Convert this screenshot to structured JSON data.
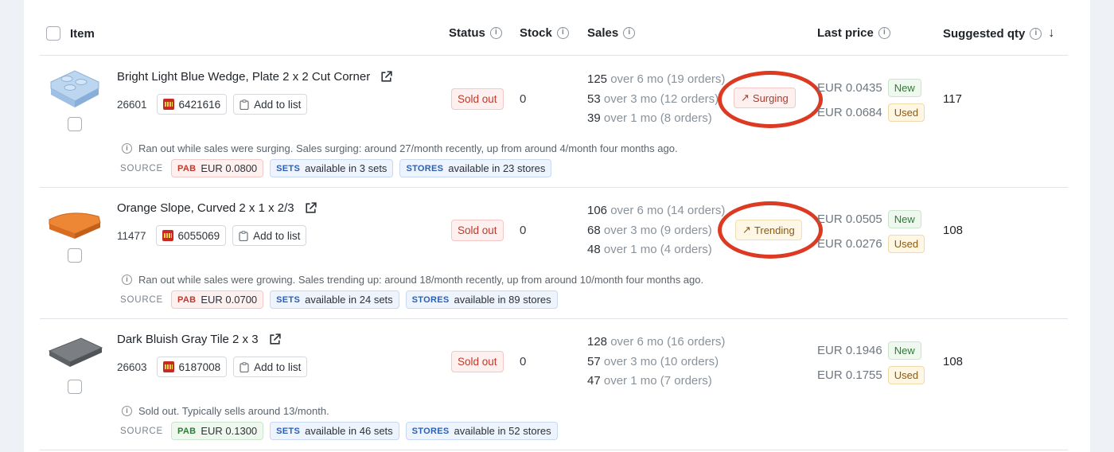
{
  "header": {
    "item": "Item",
    "status": "Status",
    "stock": "Stock",
    "sales": "Sales",
    "last_price": "Last price",
    "suggested_qty": "Suggested qty",
    "info_glyph": "i",
    "sort_glyph": "↓"
  },
  "rows": [
    {
      "title": "Bright Light Blue Wedge, Plate 2 x 2 Cut Corner",
      "part_no": "26601",
      "element_id": "6421616",
      "add_to_list": "Add to list",
      "status": "Sold out",
      "stock": "0",
      "sales": [
        {
          "count": "125",
          "text": "over 6 mo (19 orders)"
        },
        {
          "count": "53",
          "text": "over 3 mo (12 orders)"
        },
        {
          "count": "39",
          "text": "over 1 mo (8 orders)"
        }
      ],
      "trend_label": "Surging",
      "prices": [
        {
          "value": "EUR 0.0435",
          "tag": "New"
        },
        {
          "value": "EUR 0.0684",
          "tag": "Used"
        }
      ],
      "suggested_qty": "117",
      "note": "Ran out while sales were surging. Sales surging: around 27/month recently, up from around 4/month four months ago.",
      "source_label": "SOURCE",
      "pab_key": "PAB",
      "pab_value": "EUR 0.0800",
      "sets_key": "SETS",
      "sets_value": "available in 3 sets",
      "stores_key": "STORES",
      "stores_value": "available in 23 stores",
      "thumb_color": "#a9c9ea"
    },
    {
      "title": "Orange Slope, Curved 2 x 1 x 2/3",
      "part_no": "11477",
      "element_id": "6055069",
      "add_to_list": "Add to list",
      "status": "Sold out",
      "stock": "0",
      "sales": [
        {
          "count": "106",
          "text": "over 6 mo (14 orders)"
        },
        {
          "count": "68",
          "text": "over 3 mo (9 orders)"
        },
        {
          "count": "48",
          "text": "over 1 mo (4 orders)"
        }
      ],
      "trend_label": "Trending",
      "prices": [
        {
          "value": "EUR 0.0505",
          "tag": "New"
        },
        {
          "value": "EUR 0.0276",
          "tag": "Used"
        }
      ],
      "suggested_qty": "108",
      "note": "Ran out while sales were growing. Sales trending up: around 18/month recently, up from around 10/month four months ago.",
      "source_label": "SOURCE",
      "pab_key": "PAB",
      "pab_value": "EUR 0.0700",
      "sets_key": "SETS",
      "sets_value": "available in 24 sets",
      "stores_key": "STORES",
      "stores_value": "available in 89 stores",
      "thumb_color": "#e8772e"
    },
    {
      "title": "Dark Bluish Gray Tile 2 x 3",
      "part_no": "26603",
      "element_id": "6187008",
      "add_to_list": "Add to list",
      "status": "Sold out",
      "stock": "0",
      "sales": [
        {
          "count": "128",
          "text": "over 6 mo (16 orders)"
        },
        {
          "count": "57",
          "text": "over 3 mo (10 orders)"
        },
        {
          "count": "47",
          "text": "over 1 mo (7 orders)"
        }
      ],
      "trend_label": "",
      "prices": [
        {
          "value": "EUR 0.1946",
          "tag": "New"
        },
        {
          "value": "EUR 0.1755",
          "tag": "Used"
        }
      ],
      "suggested_qty": "108",
      "note": "Sold out. Typically sells around 13/month.",
      "source_label": "SOURCE",
      "pab_key": "PAB",
      "pab_value": "EUR 0.1300",
      "sets_key": "SETS",
      "sets_value": "available in 46 sets",
      "stores_key": "STORES",
      "stores_value": "available in 52 stores",
      "thumb_color": "#6c6f73"
    }
  ],
  "colors": {
    "sold_out": "#c0392b",
    "surging": "#b23a2b",
    "trending": "#8a5a10",
    "annotation_ring": "#dd3a24",
    "new_tag": "#2f7a36",
    "used_tag": "#8a5a10",
    "pab_green": "#2f7a36",
    "sets_stores_blue": "#2b5fb3"
  },
  "icons": [
    "checkbox-icon",
    "info-icon",
    "sort-desc-icon",
    "external-link-icon",
    "lego-logo-icon",
    "clipboard-icon",
    "trend-up-icon"
  ]
}
